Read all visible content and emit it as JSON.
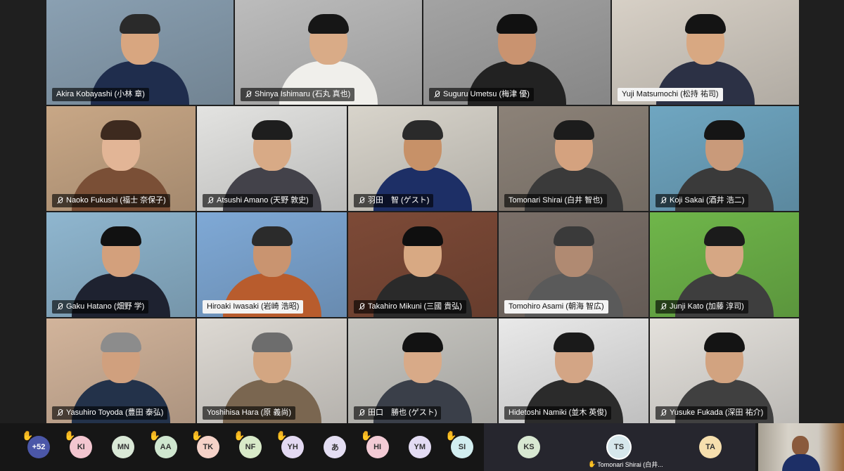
{
  "colors": {
    "background": "#1f1f1f",
    "bottom_bar": "#161616",
    "hand": "#f2b417",
    "overflow_badge": "#4b57a8"
  },
  "tiles": [
    {
      "name": "Akira Kobayashi (小林 章)",
      "muted": false,
      "label_style": "dark",
      "bg": "#8aa0b2",
      "shirt": "#1f2d4d",
      "skin": "#d8a680",
      "hair": "#2a2a2a"
    },
    {
      "name": "Shinya Ishimaru (石丸 真也)",
      "muted": true,
      "label_style": "dark",
      "bg": "#bcbcbc",
      "shirt": "#f0efeb",
      "skin": "#d9ab87",
      "hair": "#161616"
    },
    {
      "name": "Suguru Umetsu (梅津 優)",
      "muted": true,
      "label_style": "dark",
      "bg": "#a3a3a3",
      "shirt": "#222222",
      "skin": "#c99370",
      "hair": "#111111"
    },
    {
      "name": "Yuji Matsumochi (松持 祐司)",
      "muted": false,
      "label_style": "light",
      "bg": "#d7d0c6",
      "shirt": "#2c3145",
      "skin": "#d8a882",
      "hair": "#141414"
    },
    {
      "name": "Naoko Fukushi (福士 奈保子)",
      "muted": true,
      "label_style": "dark",
      "bg": "#c8a786",
      "shirt": "#7a4f36",
      "skin": "#e2b596",
      "hair": "#3d2a1f"
    },
    {
      "name": "Atsushi Amano (天野 敦史)",
      "muted": true,
      "label_style": "dark",
      "bg": "#e3e3e1",
      "shirt": "#43424a",
      "skin": "#d8aa86",
      "hair": "#1e1e1e"
    },
    {
      "name": "羽田　智 (ゲスト)",
      "muted": true,
      "label_style": "dark",
      "bg": "#d8d4cb",
      "shirt": "#1d2f66",
      "skin": "#c79168",
      "hair": "#2a2a2a"
    },
    {
      "name": "Tomonari Shirai (白井 智也)",
      "muted": false,
      "label_style": "dark",
      "bg": "#8c8278",
      "shirt": "#3a3a3a",
      "skin": "#d4a27f",
      "hair": "#1c1c1c"
    },
    {
      "name": "Koji Sakai (酒井 浩二)",
      "muted": true,
      "label_style": "dark",
      "bg": "#6fa6c1",
      "shirt": "#3a3a3a",
      "skin": "#c99a7a",
      "hair": "#151515"
    },
    {
      "name": "Gaku Hatano (畑野 学)",
      "muted": true,
      "label_style": "dark",
      "bg": "#8fb6cf",
      "shirt": "#1e2230",
      "skin": "#d3a07c",
      "hair": "#111111"
    },
    {
      "name": "Hiroaki Iwasaki (岩崎 浩昭)",
      "muted": false,
      "label_style": "light",
      "bg": "#7fa9d6",
      "shirt": "#b85c2d",
      "skin": "#c99470",
      "hair": "#2b2b2b"
    },
    {
      "name": "Takahiro Mikuni (三國 貴弘)",
      "muted": true,
      "label_style": "dark",
      "bg": "#7d4a37",
      "shirt": "#2a2a2a",
      "skin": "#d8a983",
      "hair": "#0f0f0f"
    },
    {
      "name": "Tomohiro Asami (朝海 智広)",
      "muted": false,
      "label_style": "light",
      "bg": "#7a6f68",
      "shirt": "#5a5a5a",
      "skin": "#b08a72",
      "hair": "#3a3a3a"
    },
    {
      "name": "Junji Kato (加藤 淳司)",
      "muted": true,
      "label_style": "dark",
      "bg": "#6fb64a",
      "shirt": "#3e3e3e",
      "skin": "#d6a784",
      "hair": "#1b1b1b"
    },
    {
      "name": "Yasuhiro Toyoda (豊田 泰弘)",
      "muted": true,
      "label_style": "dark",
      "bg": "#d2b49b",
      "shirt": "#23324a",
      "skin": "#d0a07e",
      "hair": "#8c8c8c"
    },
    {
      "name": "Yoshihisa Hara (原 義尚)",
      "muted": false,
      "label_style": "dark",
      "bg": "#ddd9d3",
      "shirt": "#7a6650",
      "skin": "#d3a682",
      "hair": "#6d6d6d"
    },
    {
      "name": "田口　勝也 (ゲスト)",
      "muted": true,
      "label_style": "dark",
      "bg": "#c7c6c1",
      "shirt": "#3a3f49",
      "skin": "#d8aa88",
      "hair": "#121212"
    },
    {
      "name": "Hidetoshi Namiki (並木 英俊)",
      "muted": false,
      "label_style": "dark",
      "bg": "#e9e9e9",
      "shirt": "#2b2b2b",
      "skin": "#d3a585",
      "hair": "#1a1a1a"
    },
    {
      "name": "Yusuke Fukada (深田 祐介)",
      "muted": true,
      "label_style": "dark",
      "bg": "#e4e1dc",
      "shirt": "#404040",
      "skin": "#d2a380",
      "hair": "#141414"
    }
  ],
  "bottom_bar": {
    "avatars": [
      {
        "initials": "+52",
        "hand": true,
        "color": "#4b57a8",
        "text": "#ffffff"
      },
      {
        "initials": "KI",
        "hand": true,
        "color": "#f3c6d0",
        "text": "#333333"
      },
      {
        "initials": "MN",
        "hand": false,
        "color": "#d9e8d6",
        "text": "#333333"
      },
      {
        "initials": "AA",
        "hand": true,
        "color": "#cfe6cf",
        "text": "#333333"
      },
      {
        "initials": "TK",
        "hand": true,
        "color": "#f5d2c8",
        "text": "#333333"
      },
      {
        "initials": "NF",
        "hand": true,
        "color": "#d8eac8",
        "text": "#333333"
      },
      {
        "initials": "YH",
        "hand": true,
        "color": "#e3d9f2",
        "text": "#333333"
      },
      {
        "initials": "あ",
        "hand": false,
        "color": "#e4def3",
        "text": "#333333"
      },
      {
        "initials": "HI",
        "hand": true,
        "color": "#f3cbd5",
        "text": "#333333"
      },
      {
        "initials": "YM",
        "hand": false,
        "color": "#e3dcf3",
        "text": "#333333"
      },
      {
        "initials": "SI",
        "hand": true,
        "color": "#d2eef0",
        "text": "#333333"
      }
    ],
    "spotlight": [
      {
        "initials": "KS",
        "color": "#d8e8d2",
        "text": "#333333",
        "ring": false
      },
      {
        "initials": "TS",
        "color": "#d6e7ec",
        "text": "#333333",
        "ring": true
      },
      {
        "initials": "TA",
        "color": "#f6dfae",
        "text": "#333333",
        "ring": false
      }
    ],
    "spotlight_label": "Tomonari Shirai (白井..."
  }
}
